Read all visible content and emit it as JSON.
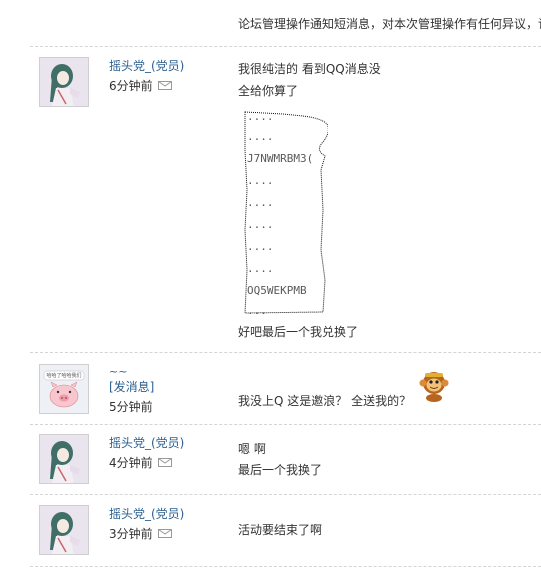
{
  "top_notice": "论坛管理操作通知短消息，对本次管理操作有任何异议，请",
  "posts": [
    {
      "username": "摇头党_(党员)",
      "time": "6分钟前",
      "lines": [
        "我很纯洁的  看到QQ消息没",
        "全给你算了"
      ],
      "codes": [
        "....",
        "....",
        "J7NWMRBM3(",
        "....",
        "....",
        "....",
        "....",
        "....",
        "OQ5WEKPMB",
        "..."
      ],
      "after": "好吧最后一个我兑换了"
    },
    {
      "tilde": "~~",
      "send_msg": "[发消息]",
      "time": "5分钟前",
      "avatar_text": "哈哈了哈哈我们",
      "lines": [
        "我没上Q    这是邀浪？  全送我的？"
      ]
    },
    {
      "username": "摇头党_(党员)",
      "time": "4分钟前",
      "lines": [
        "嗯  啊",
        "最后一个我换了"
      ]
    },
    {
      "username": "摇头党_(党员)",
      "time": "3分钟前",
      "lines": [
        "活动要结束了啊"
      ]
    }
  ]
}
